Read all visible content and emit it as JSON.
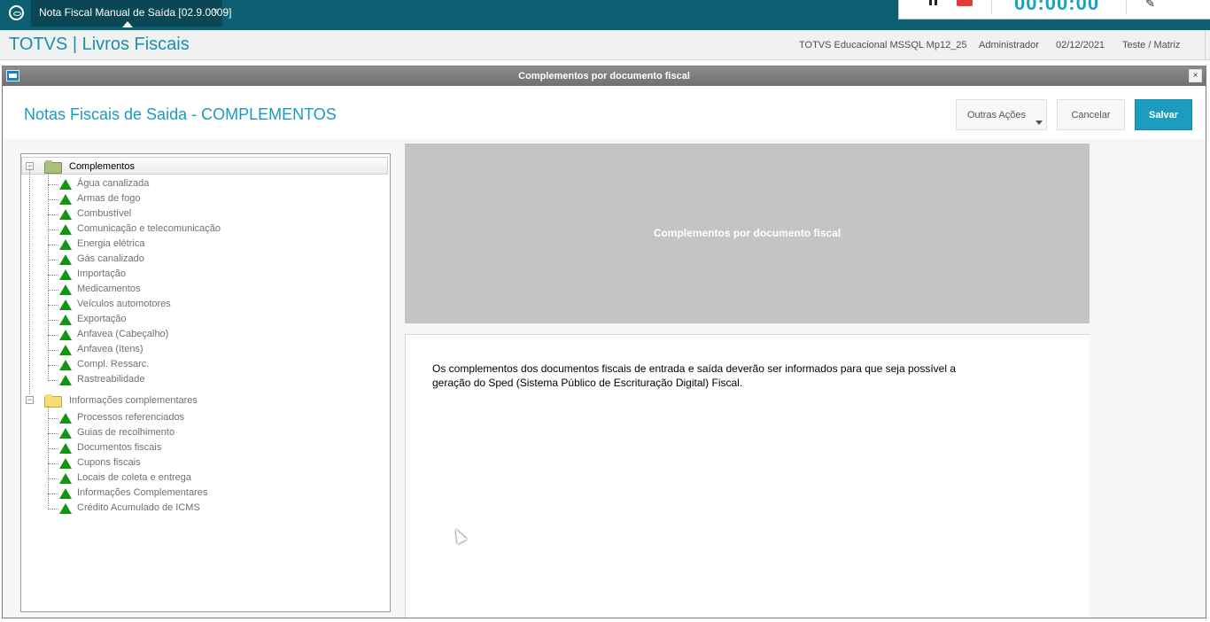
{
  "top_tab": {
    "title": "Nota Fiscal Manual de Saída [02.9.0009]",
    "close": "×"
  },
  "recorder": {
    "timer": "00:00:00",
    "pause_icon": "pause-icon",
    "stop_icon": "stop-icon",
    "pen_icon": "pen-icon"
  },
  "header": {
    "app_title": "TOTVS | Livros Fiscais",
    "environment": "TOTVS Educacional MSSQL Mp12_25",
    "user": "Administrador",
    "date": "02/12/2021",
    "company": "Teste / Matriz"
  },
  "dialog": {
    "title": "Complementos por documento fiscal",
    "close": "×",
    "heading": "Notas Fiscais de Saida - COMPLEMENTOS",
    "buttons": {
      "other_actions": "Outras Ações",
      "cancel": "Cancelar",
      "save": "Salvar"
    }
  },
  "tree": {
    "groups": [
      {
        "label": "Complementos",
        "expander": "−",
        "items": [
          "Água canalizada",
          "Armas de fogo",
          "Combustível",
          "Comunicação e telecomunicação",
          "Energia elétrica",
          "Gás canalizado",
          "Importação",
          "Medicamentos",
          "Veículos automotores",
          "Exportação",
          "Anfavea (Cabeçalho)",
          "Anfavea (Itens)",
          "Compl. Ressarc.",
          "Rastreabilidade"
        ]
      },
      {
        "label": "Informações complementares",
        "expander": "−",
        "items": [
          "Processos referenciados",
          "Guias de recolhimento",
          "Documentos fiscais",
          "Cupons fiscais",
          "Locais de coleta e entrega",
          "Informações Complementares",
          "Crédito Acumulado de ICMS"
        ]
      }
    ]
  },
  "banner": {
    "text": "Complementos por documento fiscal"
  },
  "description": {
    "line1": "Os complementos dos documentos fiscais de entrada e saída deverão ser informados para que seja possível a",
    "line2": "geração do Sped (Sistema Público de Escrituração Digital) Fiscal."
  },
  "colors": {
    "accent": "#1a9ac0",
    "topbar": "#0c5f70",
    "save_button": "#1c9cbf",
    "tree_icon": "#129612"
  }
}
